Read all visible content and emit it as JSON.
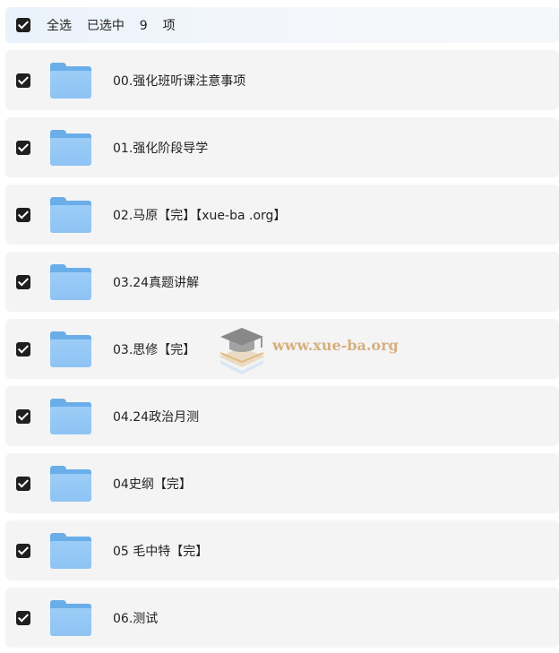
{
  "header": {
    "select_all_label": "全选  已选中  9  项"
  },
  "folders": [
    {
      "name": "00.强化班听课注意事项"
    },
    {
      "name": "01.强化阶段导学"
    },
    {
      "name": "02.马原【完】【xue-ba .org】"
    },
    {
      "name": "03.24真题讲解"
    },
    {
      "name": "03.思修【完】"
    },
    {
      "name": "04.24政治月测"
    },
    {
      "name": "04史纲【完】"
    },
    {
      "name": "05 毛中特【完】"
    },
    {
      "name": "06.测试"
    }
  ],
  "watermark": {
    "text": "www.xue-ba.org"
  },
  "icons": {
    "checkbox": "checkbox-checked-icon",
    "folder": "folder-icon",
    "logo": "graduation-cap-book-logo"
  },
  "colors": {
    "checkbox": "#1f1f1f",
    "folder": "#8ec3f4",
    "row_background": "#f4f4f5",
    "header_background": "#eaf2fb",
    "watermark": "#d2a46a"
  }
}
